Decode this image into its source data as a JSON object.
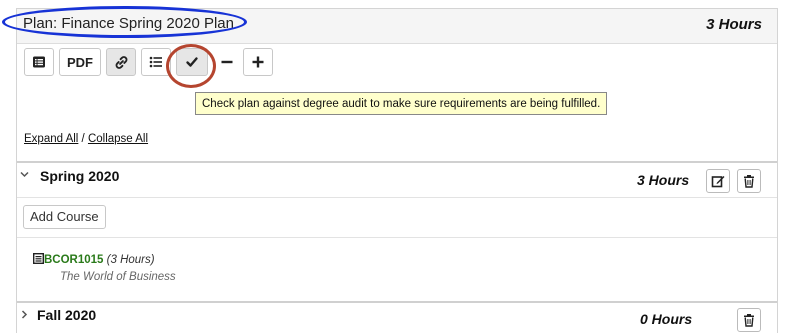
{
  "plan": {
    "title": "Plan: Finance Spring 2020 Plan",
    "hours": "3 Hours"
  },
  "toolbar": {
    "pdf_label": "PDF",
    "tooltip": "Check plan against degree audit to make sure requirements are being fulfilled."
  },
  "expand": {
    "expand_all": "Expand All",
    "separator": " / ",
    "collapse_all": "Collapse All"
  },
  "terms": [
    {
      "name": "Spring 2020",
      "hours": "3 Hours",
      "add_course_label": "Add Course",
      "courses": [
        {
          "code": "BCOR1015",
          "hours": "(3 Hours)",
          "title": "The World of Business"
        }
      ]
    },
    {
      "name": "Fall 2020",
      "hours": "0 Hours"
    }
  ],
  "colors": {
    "highlight_oval": "#1733d6",
    "highlight_circle": "#b5452f",
    "course_code": "#2a7a1a",
    "tooltip_bg": "#ffffcc"
  }
}
